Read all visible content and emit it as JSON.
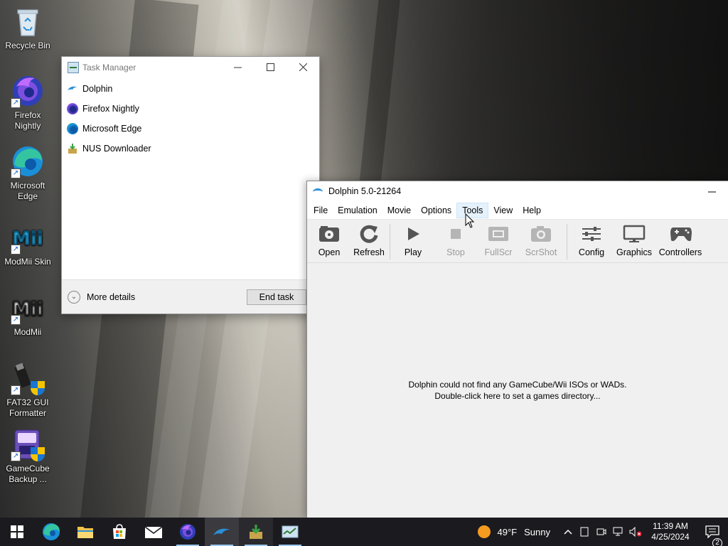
{
  "desktop": {
    "icons": [
      {
        "label": "Recycle Bin"
      },
      {
        "label": "Firefox Nightly"
      },
      {
        "label": "Microsoft Edge"
      },
      {
        "label": "ModMii Skin"
      },
      {
        "label": "ModMii"
      },
      {
        "label": "FAT32 GUI Formatter"
      },
      {
        "label": "GameCube Backup ..."
      }
    ]
  },
  "task_manager": {
    "title": "Task Manager",
    "apps": [
      {
        "name": "Dolphin",
        "icon": "dolphin-icon"
      },
      {
        "name": "Firefox Nightly",
        "icon": "firefox-nightly-icon"
      },
      {
        "name": "Microsoft Edge",
        "icon": "edge-icon"
      },
      {
        "name": "NUS Downloader",
        "icon": "nus-downloader-icon"
      }
    ],
    "more_details": "More details",
    "end_task": "End task"
  },
  "dolphin": {
    "title": "Dolphin 5.0-21264",
    "menu": [
      "File",
      "Emulation",
      "Movie",
      "Options",
      "Tools",
      "View",
      "Help"
    ],
    "toolbar": {
      "open": "Open",
      "refresh": "Refresh",
      "play": "Play",
      "stop": "Stop",
      "fullscr": "FullScr",
      "scrshot": "ScrShot",
      "config": "Config",
      "graphics": "Graphics",
      "controllers": "Controllers"
    },
    "empty_line1": "Dolphin could not find any GameCube/Wii ISOs or WADs.",
    "empty_line2": "Double-click here to set a games directory..."
  },
  "taskbar": {
    "weather_temp": "49°F",
    "weather_desc": "Sunny",
    "time": "11:39 AM",
    "date": "4/25/2024",
    "notification_count": "2"
  }
}
